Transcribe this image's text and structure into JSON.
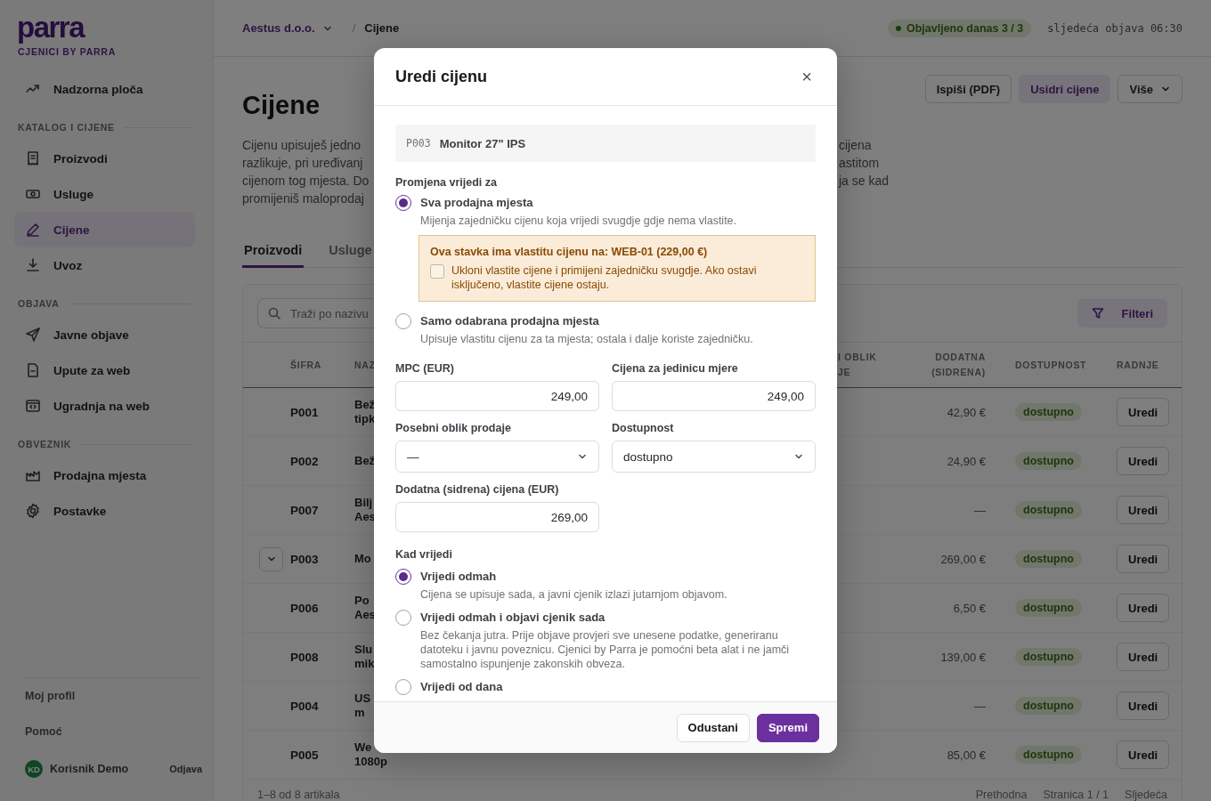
{
  "sidebar": {
    "logo": "parra",
    "subtitle": "CJENICI BY PARRA",
    "items": [
      {
        "kind": "link",
        "label": "Nadzorna ploča",
        "selected": false
      },
      {
        "kind": "section",
        "label": "KATALOG I CIJENE"
      },
      {
        "kind": "link",
        "label": "Proizvodi",
        "selected": false
      },
      {
        "kind": "link",
        "label": "Usluge",
        "selected": false
      },
      {
        "kind": "link",
        "label": "Cijene",
        "selected": true
      },
      {
        "kind": "link",
        "label": "Uvoz",
        "selected": false
      },
      {
        "kind": "section",
        "label": "OBJAVA"
      },
      {
        "kind": "link",
        "label": "Javne objave",
        "selected": false
      },
      {
        "kind": "link",
        "label": "Upute za web",
        "selected": false
      },
      {
        "kind": "link",
        "label": "Ugradnja na web",
        "selected": false
      },
      {
        "kind": "section",
        "label": "OBVEZNIK"
      },
      {
        "kind": "link",
        "label": "Prodajna mjesta",
        "selected": false
      },
      {
        "kind": "link",
        "label": "Postavke",
        "selected": false
      }
    ],
    "bottom_links": [
      "Moj profil",
      "Pomoć"
    ],
    "user": {
      "initials": "KD",
      "name": "Korisnik Demo",
      "logout": "Odjava"
    }
  },
  "topbar": {
    "company": "Aestus d.o.o.",
    "separator": "/",
    "current": "Cijene",
    "status": "Objavljeno danas 3 / 3",
    "next_publish": "sljedeća objava 06:30"
  },
  "page": {
    "title": "Cijene",
    "actions": [
      {
        "label": "Ispiši (PDF)",
        "kind": "default"
      },
      {
        "label": "Usidri cijene",
        "kind": "accent"
      },
      {
        "label": "Više",
        "kind": "menu"
      }
    ],
    "description_left": [
      "Cijenu upisuješ jedno",
      "razlikuje, pri uređivanj",
      "cijenom tog mjesta. Do",
      "promijeniš maloprodaj"
    ],
    "description_right": [
      "cijena",
      "astitom",
      "ja se kad"
    ],
    "tabs": [
      {
        "label": "Proizvodi",
        "selected": true
      },
      {
        "label": "Usluge",
        "selected": false
      }
    ]
  },
  "table": {
    "search_placeholder": "Traži po nazivu",
    "filter_button": "Filteri",
    "columns": [
      "ŠIFRA",
      "NAZ",
      "I OBLIK JE",
      "DODATNA (SIDRENA)",
      "DOSTUPNOST",
      "RADNJE"
    ],
    "rows": [
      {
        "expandable": false,
        "code": "P001",
        "name": "Bež tipk",
        "anchor_price": "42,90 €",
        "availability": "dostupno",
        "action": "Uredi"
      },
      {
        "expandable": false,
        "code": "P002",
        "name": "Bež",
        "anchor_price": "24,90 €",
        "availability": "dostupno",
        "action": "Uredi"
      },
      {
        "expandable": false,
        "code": "P007",
        "name": "Bilj Aes",
        "anchor_price": "—",
        "availability": "dostupno",
        "action": "Uredi"
      },
      {
        "expandable": true,
        "code": "P003",
        "name": "Mo",
        "anchor_price": "269,00 €",
        "availability": "dostupno",
        "action": "Uredi"
      },
      {
        "expandable": false,
        "code": "P006",
        "name": "Po Aes",
        "anchor_price": "6,50 €",
        "availability": "dostupno",
        "action": "Uredi"
      },
      {
        "expandable": false,
        "code": "P008",
        "name": "Slu mik",
        "anchor_price": "139,00 €",
        "availability": "dostupno",
        "action": "Uredi"
      },
      {
        "expandable": false,
        "code": "P004",
        "name": "US m",
        "anchor_price": "—",
        "availability": "dostupno",
        "action": "Uredi"
      },
      {
        "expandable": false,
        "code": "P005",
        "name": "We 1080p",
        "anchor_price": "85,00 €",
        "availability": "dostupno",
        "action": "Uredi"
      }
    ],
    "footer": {
      "count": "1–8 od 8 artikala",
      "prev": "Prethodna",
      "page": "Stranica 1 / 1",
      "next": "Sljedeća"
    }
  },
  "modal": {
    "title": "Uredi cijenu",
    "close": "×",
    "product": {
      "code": "P003",
      "name": "Monitor 27\" IPS"
    },
    "scope": {
      "label": "Promjena vrijedi za",
      "options": [
        {
          "label": "Sva prodajna mjesta",
          "description": "Mijenja zajedničku cijenu koja vrijedi svugdje gdje nema vlastite.",
          "selected": true
        },
        {
          "label": "Samo odabrana prodajna mjesta",
          "description": "Upisuje vlastitu cijenu za ta mjesta; ostala i dalje koriste zajedničku.",
          "selected": false
        }
      ]
    },
    "warning": {
      "title": "Ova stavka ima vlastitu cijenu na: WEB-01 (229,00 €)",
      "checkbox": {
        "label": "Ukloni vlastite cijene i primijeni zajedničku svugdje. Ako ostavi isključeno, vlastite cijene ostaju.",
        "checked": false
      }
    },
    "fields": [
      {
        "kind": "input",
        "label": "MPC (EUR)",
        "value": "249,00"
      },
      {
        "kind": "input",
        "label": "Cijena za jedinicu mjere",
        "value": "249,00"
      },
      {
        "kind": "select",
        "label": "Posebni oblik prodaje",
        "value": "—"
      },
      {
        "kind": "select",
        "label": "Dostupnost",
        "value": "dostupno"
      },
      {
        "kind": "input",
        "label": "Dodatna (sidrena) cijena (EUR)",
        "value": "269,00"
      }
    ],
    "timing": {
      "label": "Kad vrijedi",
      "options": [
        {
          "label": "Vrijedi odmah",
          "description": "Cijena se upisuje sada, a javni cjenik izlazi jutarnjom objavom.",
          "selected": true
        },
        {
          "label": "Vrijedi odmah i objavi cjenik sada",
          "description": "Bez čekanja jutra. Prije objave provjeri sve unesene podatke, generiranu datoteku i javnu poveznicu. Cjenici by Parra je pomoćni beta alat i ne jamči samostalno ispunjenje zakonskih obveza.",
          "selected": false
        },
        {
          "label": "Vrijedi od dana",
          "selected": false
        }
      ]
    },
    "buttons": [
      {
        "label": "Odustani",
        "kind": "secondary"
      },
      {
        "label": "Spremi",
        "kind": "primary"
      }
    ]
  }
}
